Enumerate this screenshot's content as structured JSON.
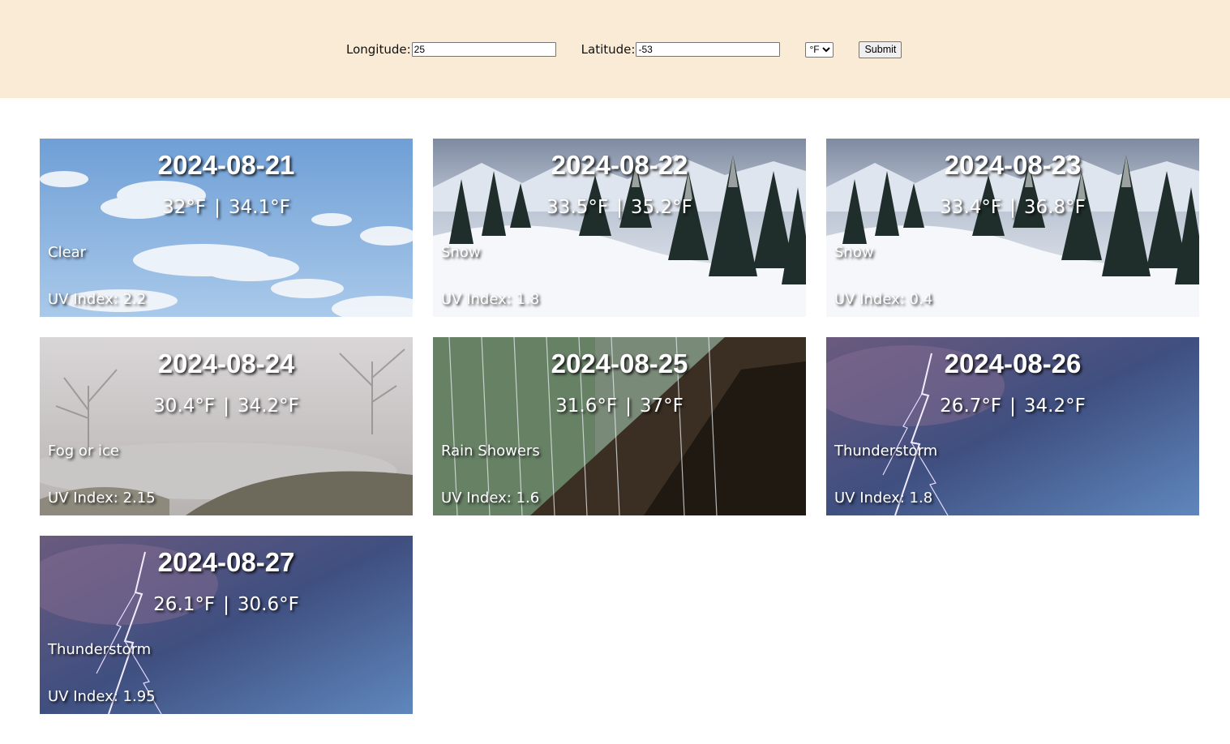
{
  "form": {
    "longitude_label": "Longitude:",
    "longitude_value": "25",
    "latitude_label": "Latitude:",
    "latitude_value": "-53",
    "unit_selected": "°F",
    "submit_label": "Submit"
  },
  "cards": [
    {
      "date": "2024-08-21",
      "low": "32°F",
      "high": "34.1°F",
      "separator": "|",
      "condition": "Clear",
      "uv": "UV Index: 2.2",
      "scene": "clear-sky"
    },
    {
      "date": "2024-08-22",
      "low": "33.5°F",
      "high": "35.2°F",
      "separator": "|",
      "condition": "Snow",
      "uv": "UV Index: 1.8",
      "scene": "snow-forest"
    },
    {
      "date": "2024-08-23",
      "low": "33.4°F",
      "high": "36.8°F",
      "separator": "|",
      "condition": "Snow",
      "uv": "UV Index: 0.4",
      "scene": "snow-forest"
    },
    {
      "date": "2024-08-24",
      "low": "30.4°F",
      "high": "34.2°F",
      "separator": "|",
      "condition": "Fog or ice",
      "uv": "UV Index: 2.15",
      "scene": "fog"
    },
    {
      "date": "2024-08-25",
      "low": "31.6°F",
      "high": "37°F",
      "separator": "|",
      "condition": "Rain Showers",
      "uv": "UV Index: 1.6",
      "scene": "rain"
    },
    {
      "date": "2024-08-26",
      "low": "26.7°F",
      "high": "34.2°F",
      "separator": "|",
      "condition": "Thunderstorm",
      "uv": "UV Index: 1.8",
      "scene": "thunderstorm"
    },
    {
      "date": "2024-08-27",
      "low": "26.1°F",
      "high": "30.6°F",
      "separator": "|",
      "condition": "Thunderstorm",
      "uv": "UV Index: 1.95",
      "scene": "thunderstorm"
    }
  ]
}
